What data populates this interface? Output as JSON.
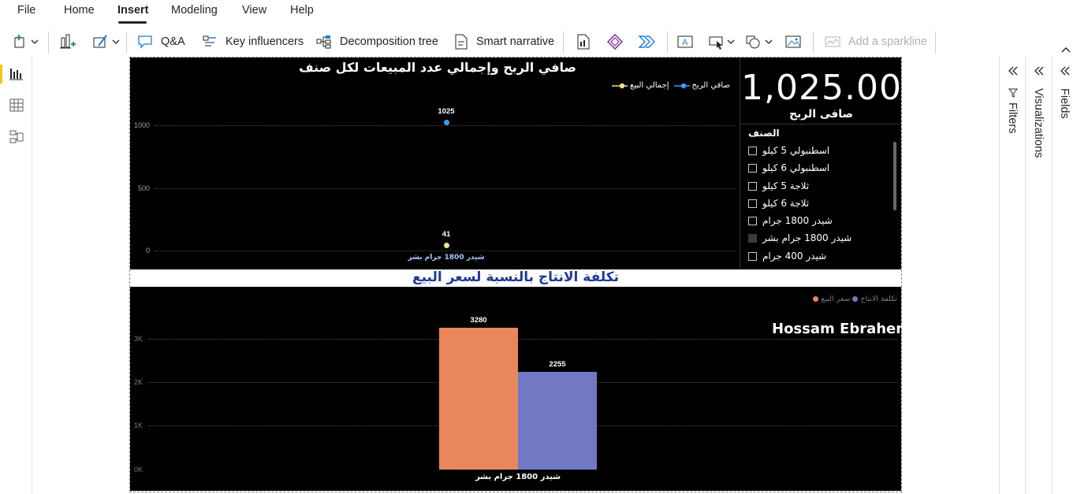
{
  "menu": {
    "items": [
      "File",
      "Home",
      "Insert",
      "Modeling",
      "View",
      "Help"
    ],
    "active": "Insert"
  },
  "ribbon": {
    "qa_label": "Q&A",
    "key_influencers_label": "Key influencers",
    "decomposition_tree_label": "Decomposition tree",
    "smart_narrative_label": "Smart narrative",
    "add_sparkline_label": "Add a sparkline"
  },
  "panes": {
    "filters": "Filters",
    "visualizations": "Visualizations",
    "fields": "Fields"
  },
  "colors": {
    "accent": "#f2c811",
    "profit_series": "#3a9bff",
    "sales_series": "#f0e08a",
    "bar_sale_price": "#e8875c",
    "bar_production_cost": "#7079c2"
  },
  "top_chart": {
    "title": "صافي الربح وإجمالي عدد المبيعات لكل صنف",
    "legend": [
      "صافي الربح",
      "إجمالي البيع"
    ],
    "y_ticks": [
      "1000",
      "500",
      "0"
    ]
  },
  "card": {
    "value": "1,025.00",
    "label": "صافى الربح"
  },
  "slicer": {
    "title": "الصنف",
    "items": [
      {
        "label": "اسطنبولي 5 كيلو",
        "checked": false
      },
      {
        "label": "اسطنبولي 6 كيلو",
        "checked": false
      },
      {
        "label": "ثلاجة 5 كيلو",
        "checked": false
      },
      {
        "label": "ثلاجة 6 كيلو",
        "checked": false
      },
      {
        "label": "شيدر 1800 جرام",
        "checked": false
      },
      {
        "label": "شيدر 1800 جرام بشر",
        "checked": true
      },
      {
        "label": "شيدر 400 جرام",
        "checked": false
      }
    ]
  },
  "bottom_chart": {
    "title": "تكلفة الانتاج بالنسبة لسعر البيع",
    "legend": [
      "تكلفة الانتاج",
      "سعر البيع"
    ],
    "author": "Hossam Ebrahem",
    "y_ticks": [
      "3K",
      "2K",
      "1K",
      "0K"
    ]
  },
  "chart_data": [
    {
      "type": "line",
      "title": "صافي الربح وإجمالي عدد المبيعات لكل صنف",
      "categories": [
        "شيدر 1800 جرام بشر"
      ],
      "series": [
        {
          "name": "صافي الربح",
          "values": [
            1025
          ]
        },
        {
          "name": "إجمالي البيع",
          "values": [
            41
          ]
        }
      ],
      "ylim": [
        0,
        1100
      ],
      "y_ticks": [
        0,
        500,
        1000
      ],
      "grid": true,
      "legend": "top-right"
    },
    {
      "type": "bar",
      "title": "تكلفة الانتاج بالنسبة لسعر البيع",
      "categories": [
        "شيدر 1800 جرام بشر"
      ],
      "series": [
        {
          "name": "سعر البيع",
          "values": [
            3280
          ]
        },
        {
          "name": "تكلفة الانتاج",
          "values": [
            2255
          ]
        }
      ],
      "ylim": [
        0,
        3500
      ],
      "y_ticks": [
        0,
        1000,
        2000,
        3000
      ],
      "grid": true,
      "legend": "top-right"
    }
  ]
}
